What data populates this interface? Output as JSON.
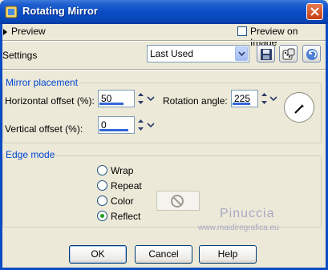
{
  "window": {
    "title": "Rotating Mirror"
  },
  "preview": {
    "label": "Preview",
    "preview_on_image_label": "Preview on Image",
    "preview_on_image_checked": false
  },
  "settings": {
    "label": "Settings",
    "selected": "Last Used"
  },
  "mirror_placement": {
    "title": "Mirror placement",
    "horizontal_offset": {
      "label": "Horizontal offset (%):",
      "value": "50"
    },
    "vertical_offset": {
      "label": "Vertical offset (%):",
      "value": "0"
    },
    "rotation_angle": {
      "label": "Rotation angle:",
      "value": "225"
    }
  },
  "edge_mode": {
    "title": "Edge mode",
    "options": [
      {
        "label": "Wrap",
        "selected": false
      },
      {
        "label": "Repeat",
        "selected": false
      },
      {
        "label": "Color",
        "selected": false
      },
      {
        "label": "Reflect",
        "selected": true
      }
    ]
  },
  "watermark": {
    "name": "Pinuccia",
    "url": "www.maidiregrafica.eu"
  },
  "buttons": {
    "ok": "OK",
    "cancel": "Cancel",
    "help": "Help"
  },
  "colors": {
    "titlebar": "#0a4cc4",
    "group_title": "#0046d5",
    "dialog_bg": "#ECE9D8",
    "selected_radio": "#21a121"
  }
}
